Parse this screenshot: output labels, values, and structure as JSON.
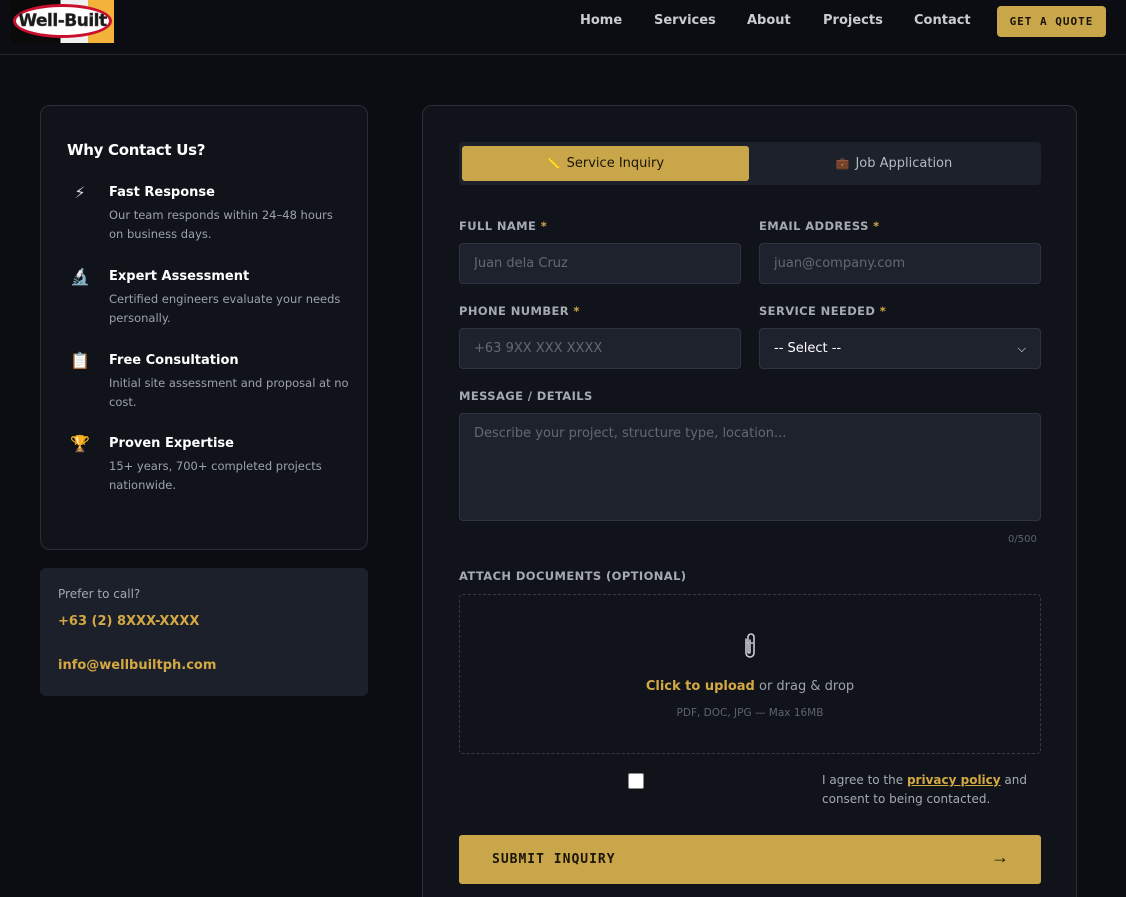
{
  "header": {
    "logo_text": "Well-Built",
    "nav": [
      "Home",
      "Services",
      "About",
      "Projects",
      "Contact"
    ],
    "cta": "GET A QUOTE"
  },
  "why": {
    "title": "Why Contact Us?",
    "items": [
      {
        "icon": "lightning-icon",
        "glyph": "⚡",
        "title": "Fast Response",
        "desc": "Our team responds within 24–48 hours on business days."
      },
      {
        "icon": "microscope-icon",
        "glyph": "🔬",
        "title": "Expert Assessment",
        "desc": "Certified engineers evaluate your needs personally."
      },
      {
        "icon": "clipboard-icon",
        "glyph": "📋",
        "title": "Free Consultation",
        "desc": "Initial site assessment and proposal at no cost."
      },
      {
        "icon": "trophy-icon",
        "glyph": "🏆",
        "title": "Proven Expertise",
        "desc": "15+ years, 700+ completed projects nationwide."
      }
    ]
  },
  "call": {
    "label": "Prefer to call?",
    "phone": "+63 (2) 8XXX-XXXX",
    "email": "info@wellbuiltph.com"
  },
  "tabs": {
    "active": {
      "icon": "ruler-icon",
      "glyph": "📏",
      "label": "Service Inquiry"
    },
    "inactive": {
      "icon": "briefcase-icon",
      "glyph": "💼",
      "label": "Job Application"
    }
  },
  "form": {
    "full_name": {
      "label": "FULL NAME",
      "placeholder": "Juan dela Cruz"
    },
    "email": {
      "label": "EMAIL ADDRESS",
      "placeholder": "juan@company.com"
    },
    "phone": {
      "label": "PHONE NUMBER",
      "placeholder": "+63 9XX XXX XXXX"
    },
    "service": {
      "label": "SERVICE NEEDED",
      "value": "-- Select --"
    },
    "message": {
      "label": "MESSAGE / DETAILS",
      "placeholder": "Describe your project, structure type, location...",
      "counter": "0/500"
    },
    "required_mark": "*",
    "attach": {
      "label": "ATTACH DOCUMENTS (OPTIONAL)",
      "strong": "Click to upload",
      "rest": " or drag & drop",
      "hint": "PDF, DOC, JPG — Max 16MB"
    },
    "agree": {
      "before": "I agree to the ",
      "link": "privacy policy",
      "after": " and consent to being contacted."
    },
    "submit": "SUBMIT INQUIRY",
    "submit_arrow": "→"
  },
  "colors": {
    "accent": "#c9a64a",
    "accent_text": "#d4a843",
    "bg": "#0b0d12",
    "card": "#10131a"
  }
}
